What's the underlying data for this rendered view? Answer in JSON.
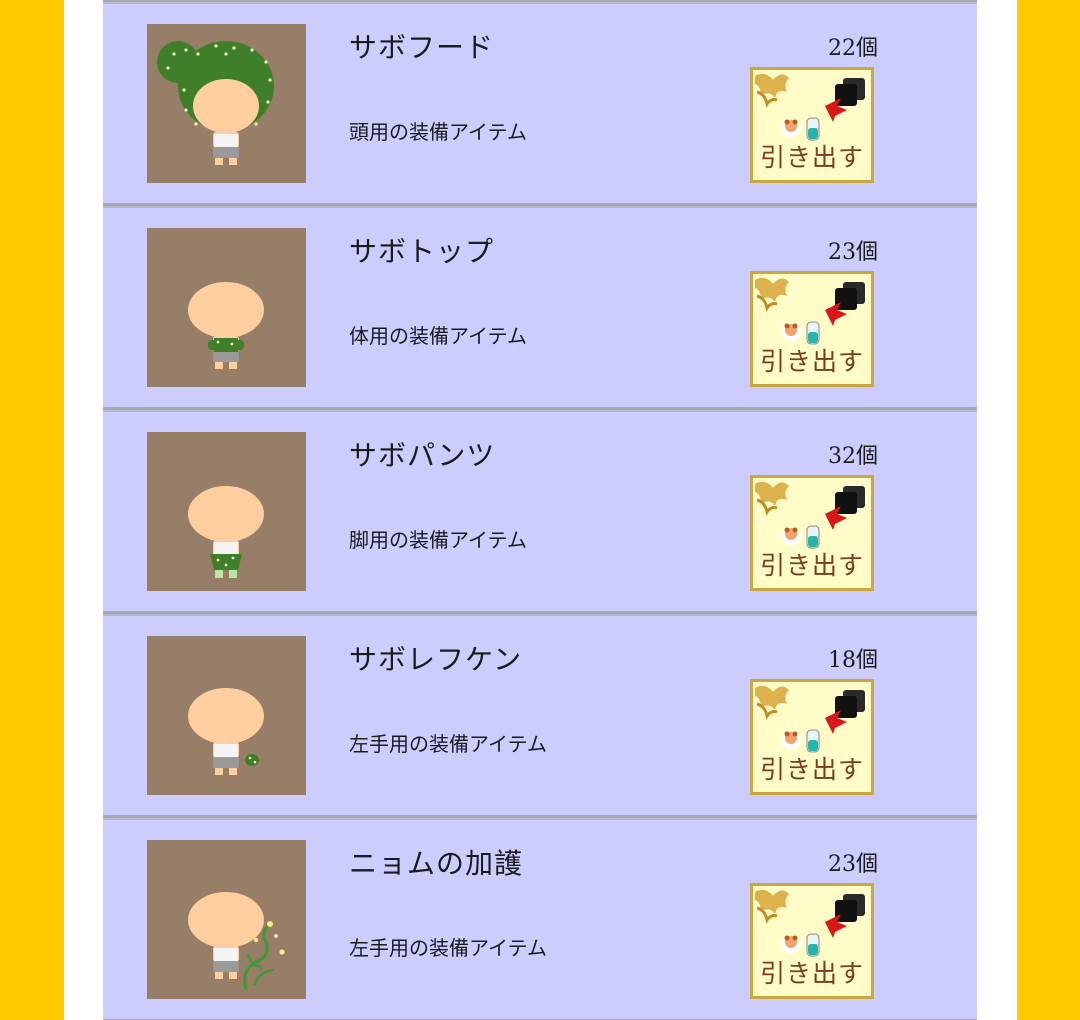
{
  "items": [
    {
      "name": "サボフード",
      "description": "頭用の装備アイテム",
      "count": "22個",
      "button_label": "引き出す",
      "thumb_icon": "cactus-hood-icon"
    },
    {
      "name": "サボトップ",
      "description": "体用の装備アイテム",
      "count": "23個",
      "button_label": "引き出す",
      "thumb_icon": "cactus-top-icon"
    },
    {
      "name": "サボパンツ",
      "description": "脚用の装備アイテム",
      "count": "32個",
      "button_label": "引き出す",
      "thumb_icon": "cactus-pants-icon"
    },
    {
      "name": "サボレフケン",
      "description": "左手用の装備アイテム",
      "count": "18個",
      "button_label": "引き出す",
      "thumb_icon": "cactus-sword-icon"
    },
    {
      "name": "ニョムの加護",
      "description": "左手用の装備アイテム",
      "count": "23個",
      "button_label": "引き出す",
      "thumb_icon": "vine-blessing-icon"
    }
  ],
  "colors": {
    "outer_background": "#ffcc00",
    "row_background": "#ccccff",
    "thumbnail_background": "#977e66",
    "button_background": "#fffcc8",
    "button_border": "#c9a640",
    "button_text": "#7a3b1e"
  }
}
